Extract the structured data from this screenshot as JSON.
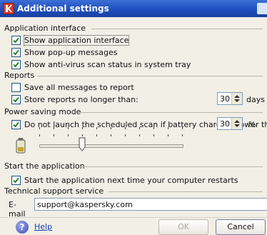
{
  "window": {
    "title": "Additional settings"
  },
  "sections": {
    "app_interface": "Application interface",
    "reports": "Reports",
    "power": "Power saving mode",
    "start": "Start the application",
    "support": "Technical support service"
  },
  "options": {
    "show_interface": {
      "label": "Show application interface",
      "checked": true
    },
    "show_popups": {
      "label": "Show pop-up messages",
      "checked": true
    },
    "show_av_status": {
      "label": "Show anti-virus scan status in system tray",
      "checked": true
    },
    "save_all_messages": {
      "label": "Save all messages to report",
      "checked": false
    },
    "store_reports": {
      "label": "Store reports no longer than:",
      "checked": true
    },
    "battery_scan": {
      "label": "Do not launch the scheduled scan if battery charge is lower than",
      "checked": true
    },
    "start_next_time": {
      "label": "Start the application next time your computer restarts",
      "checked": true
    }
  },
  "reports_days": {
    "value": "30",
    "unit": "days"
  },
  "battery_threshold": {
    "value": "30",
    "unit": "%"
  },
  "battery_slider": {
    "level_percent": 30
  },
  "support": {
    "email_label": "E-mail",
    "email_value": "support@kaspersky.com"
  },
  "footer": {
    "help_label": "Help",
    "ok_label": "OK",
    "cancel_label": "Cancel"
  },
  "icons": {
    "app": "kaspersky-app-icon",
    "check": "check-icon",
    "battery": "battery-icon",
    "help": "help-icon"
  }
}
